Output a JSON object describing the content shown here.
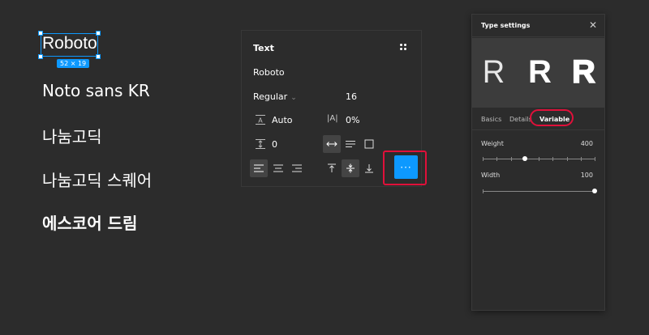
{
  "samples": {
    "roboto": "Roboto",
    "roboto_dims": "52 × 19",
    "noto": "Noto sans KR",
    "nanum_gothic": "나눔고딕",
    "nanum_square": "나눔고딕 스퀘어",
    "s_core_dream": "에스코어 드림"
  },
  "text_panel": {
    "title": "Text",
    "font_family": "Roboto",
    "font_weight": "Regular",
    "font_size": "16",
    "line_height": "Auto",
    "letter_spacing": "0%",
    "paragraph_spacing": "0",
    "more_label": "···",
    "icons": {
      "grid": "four-dots-icon",
      "line_height": "line-height-icon",
      "letter_spacing": "letter-spacing-icon",
      "paragraph_spacing": "paragraph-spacing-icon",
      "auto_width": "auto-width-icon",
      "auto_height": "auto-height-icon",
      "fixed_size": "fixed-size-icon",
      "align_left": "align-left-icon",
      "align_center": "align-center-icon",
      "align_right": "align-right-icon",
      "align_top": "align-top-icon",
      "align_middle": "align-middle-icon",
      "align_bottom": "align-bottom-icon"
    }
  },
  "type_settings": {
    "title": "Type settings",
    "close": "✕",
    "preview_glyph": "R",
    "tabs": [
      "Basics",
      "Details",
      "Variable"
    ],
    "active_tab": "Variable",
    "weight_label": "Weight",
    "weight_value": "400",
    "weight_fraction": 0.375,
    "width_label": "Width",
    "width_value": "100",
    "width_fraction": 1.0
  },
  "colors": {
    "background": "#2c2c2c",
    "accent": "#0d99ff",
    "highlight": "#e0103a"
  }
}
